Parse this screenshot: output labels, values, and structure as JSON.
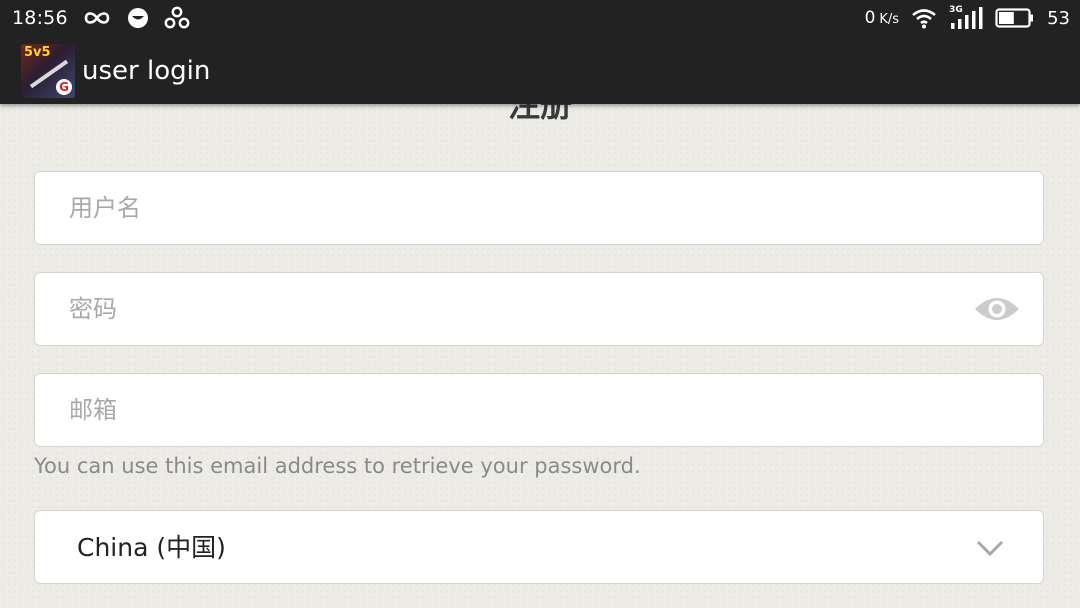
{
  "status_bar": {
    "time": "18:56",
    "net_speed_value": "0",
    "net_speed_unit": "K/s",
    "network_type": "3G",
    "battery_level": "53",
    "icons": [
      "infinity-icon",
      "chat-bubble-icon",
      "tunnel-icon",
      "wifi-icon",
      "signal-icon",
      "battery-icon"
    ]
  },
  "app_bar": {
    "app_icon_text": "5v5",
    "app_icon_mark": "G",
    "title": "user login"
  },
  "form": {
    "heading": "注册",
    "username": {
      "placeholder": "用户名",
      "value": ""
    },
    "password": {
      "placeholder": "密码",
      "value": ""
    },
    "email": {
      "placeholder": "邮箱",
      "value": ""
    },
    "email_hint": "You can use this email address to retrieve your password.",
    "country": {
      "selected": "China (中国)"
    }
  },
  "colors": {
    "status_bar_bg": "#222222",
    "page_bg": "#ecebe6",
    "field_bg": "#ffffff",
    "placeholder": "#a9a9a9",
    "hint": "#8a8a8a",
    "icon_gray": "#cccccc"
  }
}
